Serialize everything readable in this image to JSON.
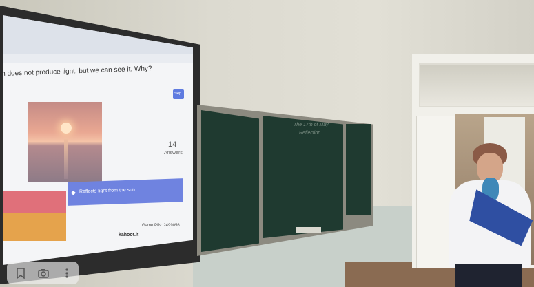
{
  "kahoot": {
    "question": "n does not produce light, but we can see it. Why?",
    "answers_count": "14",
    "answers_label": "Answers",
    "answer_option": "Reflects light from the sun",
    "footer_brand": "kahoot.it",
    "footer_game_pin": "Game PIN: 2499056",
    "skip_label": "Skip"
  },
  "chalkboard": {
    "writing_line1": "The 17th of May",
    "writing_line2": "Reflection"
  },
  "viewer_toolbar": {
    "icons": [
      "bookmark-icon",
      "camera-icon",
      "more-vertical-icon"
    ]
  },
  "colors": {
    "answer_blue": "#6f83e0",
    "answer_red": "#e0707a",
    "answer_orange": "#e5a34c",
    "chalkboard": "#1f3a30"
  }
}
